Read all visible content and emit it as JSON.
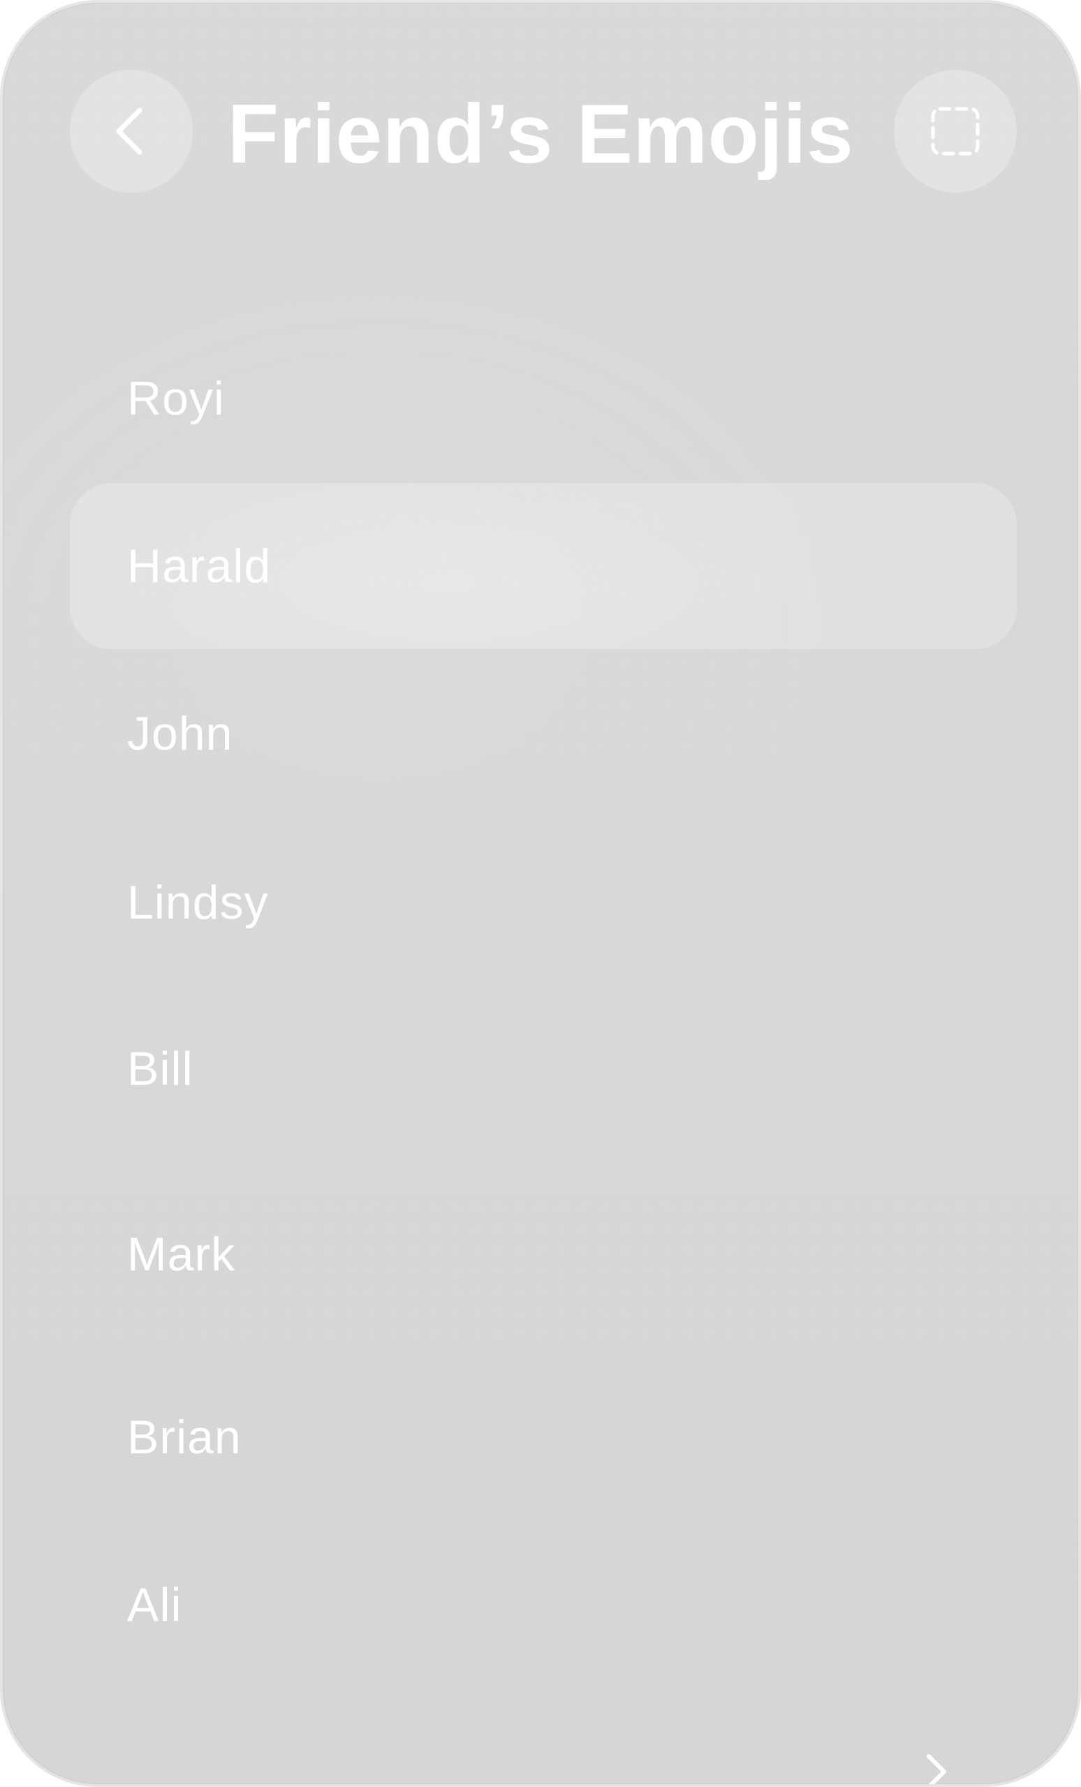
{
  "header": {
    "title": "Friend’s Emojis",
    "back_icon": "chevron-left-icon",
    "select_icon": "dashed-selection-icon"
  },
  "friends": {
    "items": [
      {
        "name": "Royi",
        "selected": false
      },
      {
        "name": "Harald",
        "selected": true
      },
      {
        "name": "John",
        "selected": false
      },
      {
        "name": "Lindsy",
        "selected": false
      },
      {
        "name": "Bill",
        "selected": false
      },
      {
        "name": "Mark",
        "selected": false
      },
      {
        "name": "Brian",
        "selected": false
      },
      {
        "name": "Ali",
        "selected": false
      }
    ]
  },
  "footer": {
    "more_icon": "chevron-right-icon"
  },
  "colors": {
    "background": "#d8d8d8",
    "text": "#ffffff",
    "selected_row": "#e2e2e2"
  }
}
